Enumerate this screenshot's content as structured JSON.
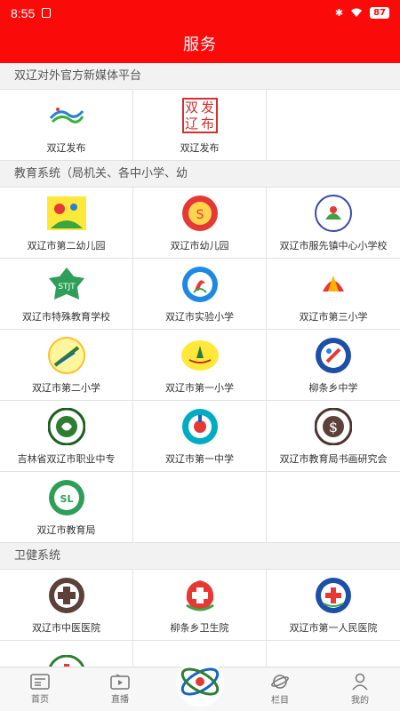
{
  "status_bar": {
    "time": "8:55",
    "battery": "87"
  },
  "header": {
    "title": "服务"
  },
  "sections": [
    {
      "title": "双辽对外官方新媒体平台",
      "items": [
        {
          "label": "双辽发布",
          "icon": "shuangliao-fabu-logo"
        },
        {
          "label": "双辽发布",
          "icon": "shuangliao-fabu-calligraphy-logo",
          "logo_text": "双发辽布"
        },
        {
          "label": "",
          "icon": ""
        }
      ]
    },
    {
      "title": "教育系统（局机关、各中小学、幼",
      "items": [
        {
          "label": "双辽市第二幼儿园",
          "icon": "kindergarten-2-logo"
        },
        {
          "label": "双辽市幼儿园",
          "icon": "kindergarten-logo"
        },
        {
          "label": "双辽市服先镇中心小学校",
          "icon": "fuxian-school-logo"
        },
        {
          "label": "双辽市特殊教育学校",
          "icon": "special-education-logo",
          "logo_text": "STJT"
        },
        {
          "label": "双辽市实验小学",
          "icon": "experimental-school-logo"
        },
        {
          "label": "双辽市第三小学",
          "icon": "school-3-logo"
        },
        {
          "label": "双辽市第二小学",
          "icon": "school-2-logo"
        },
        {
          "label": "双辽市第一小学",
          "icon": "school-1-logo"
        },
        {
          "label": "柳条乡中学",
          "icon": "liutiao-middle-school-logo"
        },
        {
          "label": "吉林省双辽市职业中专",
          "icon": "vocational-school-logo"
        },
        {
          "label": "双辽市第一中学",
          "icon": "no1-middle-school-logo"
        },
        {
          "label": "双辽市教育局书画研究会",
          "icon": "calligraphy-society-logo"
        },
        {
          "label": "双辽市教育局",
          "icon": "education-bureau-logo",
          "logo_text": "SL"
        },
        {
          "label": "",
          "icon": ""
        },
        {
          "label": "",
          "icon": ""
        }
      ]
    },
    {
      "title": "卫健系统",
      "items": [
        {
          "label": "双辽市中医医院",
          "icon": "tcm-hospital-logo"
        },
        {
          "label": "柳条乡卫生院",
          "icon": "health-center-logo"
        },
        {
          "label": "双辽市第一人民医院",
          "icon": "peoples-hospital-logo"
        },
        {
          "label": "",
          "icon": "partial-logo"
        },
        {
          "label": "",
          "icon": ""
        },
        {
          "label": "",
          "icon": ""
        }
      ]
    }
  ],
  "tabbar": [
    {
      "label": "首页",
      "icon": "home-news-icon"
    },
    {
      "label": "直播",
      "icon": "live-tv-icon"
    },
    {
      "label": "",
      "icon": "center-brand-logo"
    },
    {
      "label": "栏目",
      "icon": "column-planet-icon"
    },
    {
      "label": "我的",
      "icon": "profile-icon"
    }
  ],
  "colors": {
    "accent": "#fb0a0a",
    "background": "#f2f2f2"
  }
}
